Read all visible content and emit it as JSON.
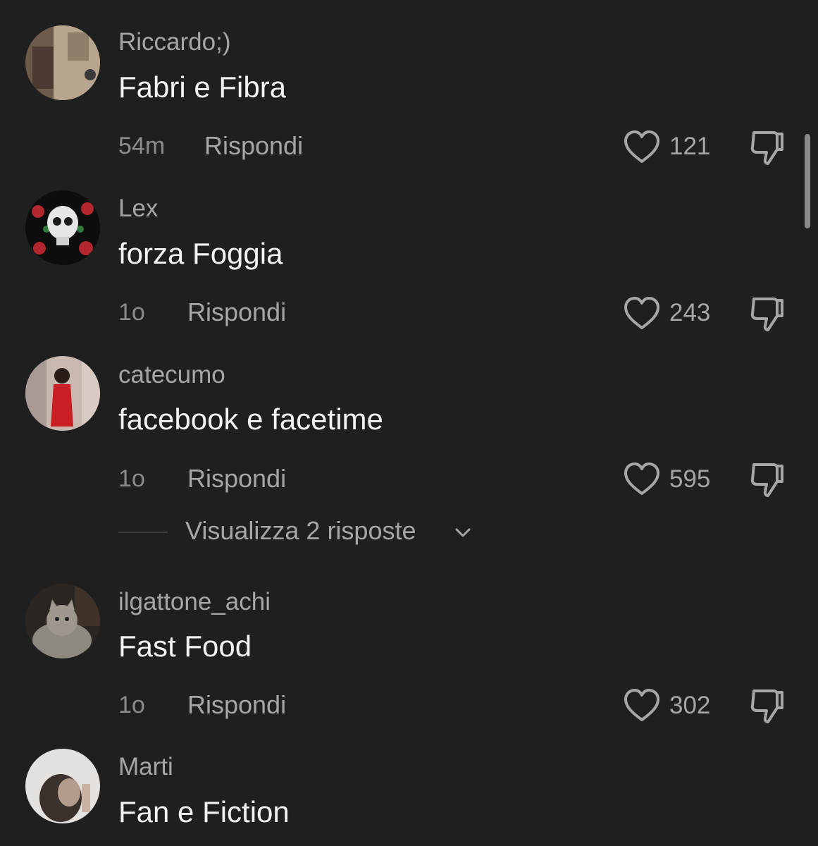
{
  "reply_label": "Rispondi",
  "icons": {
    "like": "heart-outline-icon",
    "dislike": "thumbs-down-icon",
    "expand": "chevron-down-icon"
  },
  "colors": {
    "background": "#1f1f1f",
    "username": "#a6a6a6",
    "comment_text": "#f2f2f2",
    "meta": "#8c8c8c"
  },
  "comments": [
    {
      "username": "Riccardo;)",
      "text": "Fabri e Fibra",
      "time": "54m",
      "likes": "121"
    },
    {
      "username": "Lex",
      "text": "forza Foggia",
      "time": "1o",
      "likes": "243"
    },
    {
      "username": "catecumo",
      "text": "facebook e facetime",
      "time": "1o",
      "likes": "595",
      "view_replies": "Visualizza 2 risposte"
    },
    {
      "username": "ilgattone_achi",
      "text": "Fast Food",
      "time": "1o",
      "likes": "302"
    },
    {
      "username": "Marti",
      "text": "Fan e Fiction"
    }
  ]
}
